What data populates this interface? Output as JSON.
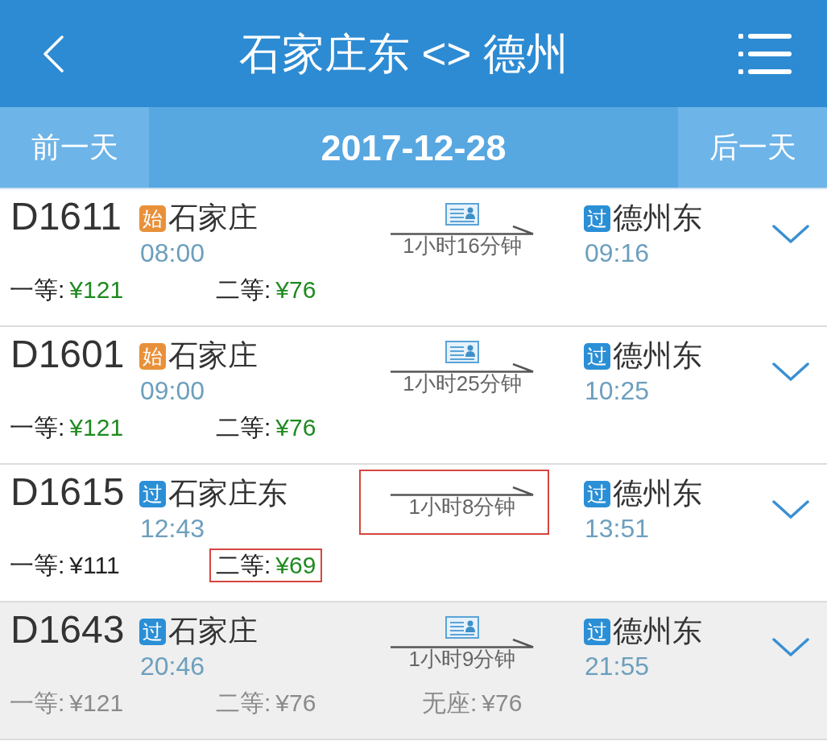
{
  "header": {
    "title": "石家庄东 <> 德州"
  },
  "date_bar": {
    "prev": "前一天",
    "date": "2017-12-28",
    "next": "后一天"
  },
  "trains": [
    {
      "number": "D1611",
      "disabled": false,
      "id_card": true,
      "from": {
        "tag": {
          "text": "始",
          "color": "#e8913a"
        },
        "station": "石家庄",
        "time": "08:00"
      },
      "duration": {
        "text": "1小时16分钟",
        "highlighted": false
      },
      "to": {
        "tag": {
          "text": "过",
          "color": "#2b8fd6"
        },
        "station": "德州东",
        "time": "09:16"
      },
      "prices": [
        {
          "label": "一等:",
          "price": "¥121",
          "available": true,
          "highlighted": false
        },
        {
          "label": "二等:",
          "price": "¥76",
          "available": true,
          "highlighted": false
        }
      ]
    },
    {
      "number": "D1601",
      "disabled": false,
      "id_card": true,
      "from": {
        "tag": {
          "text": "始",
          "color": "#e8913a"
        },
        "station": "石家庄",
        "time": "09:00"
      },
      "duration": {
        "text": "1小时25分钟",
        "highlighted": false
      },
      "to": {
        "tag": {
          "text": "过",
          "color": "#2b8fd6"
        },
        "station": "德州东",
        "time": "10:25"
      },
      "prices": [
        {
          "label": "一等:",
          "price": "¥121",
          "available": true,
          "highlighted": false
        },
        {
          "label": "二等:",
          "price": "¥76",
          "available": true,
          "highlighted": false
        }
      ]
    },
    {
      "number": "D1615",
      "disabled": false,
      "id_card": false,
      "from": {
        "tag": {
          "text": "过",
          "color": "#2b8fd6"
        },
        "station": "石家庄东",
        "time": "12:43"
      },
      "duration": {
        "text": "1小时8分钟",
        "highlighted": true
      },
      "to": {
        "tag": {
          "text": "过",
          "color": "#2b8fd6"
        },
        "station": "德州东",
        "time": "13:51"
      },
      "prices": [
        {
          "label": "一等:",
          "price": "¥111",
          "available": false,
          "highlighted": false
        },
        {
          "label": "二等:",
          "price": "¥69",
          "available": true,
          "highlighted": true
        }
      ]
    },
    {
      "number": "D1643",
      "disabled": true,
      "id_card": true,
      "from": {
        "tag": {
          "text": "过",
          "color": "#2b8fd6"
        },
        "station": "石家庄",
        "time": "20:46"
      },
      "duration": {
        "text": "1小时9分钟",
        "highlighted": false
      },
      "to": {
        "tag": {
          "text": "过",
          "color": "#2b8fd6"
        },
        "station": "德州东",
        "time": "21:55"
      },
      "prices": [
        {
          "label": "一等:",
          "price": "¥121",
          "highlighted": false
        },
        {
          "label": "二等:",
          "price": "¥76",
          "highlighted": false
        },
        {
          "label": "无座:",
          "price": "¥76",
          "highlighted": false
        }
      ]
    }
  ]
}
